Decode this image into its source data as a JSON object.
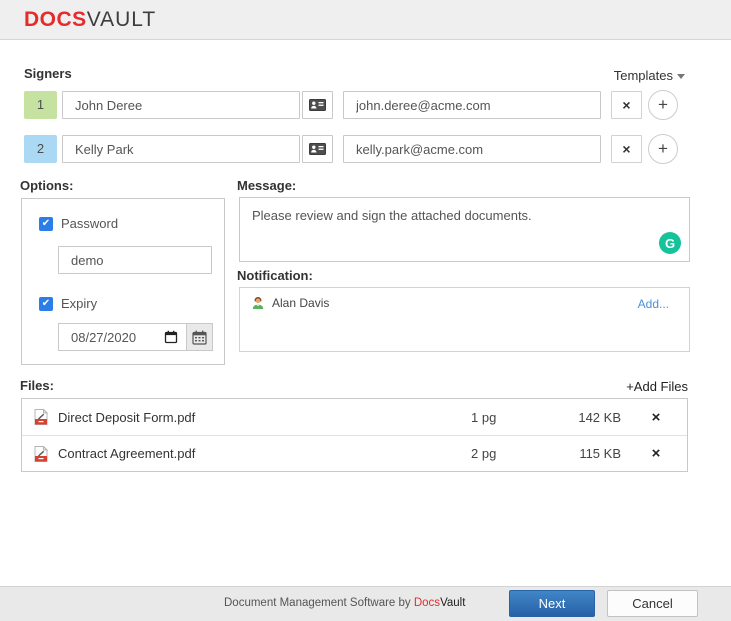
{
  "logo": {
    "docs": "DOCS",
    "vault": "VAULT"
  },
  "signers": {
    "label": "Signers",
    "templates_label": "Templates",
    "remove_label": "×",
    "add_label": "+",
    "rows": [
      {
        "order": "1",
        "name": "John Deree",
        "email": "john.deree@acme.com"
      },
      {
        "order": "2",
        "name": "Kelly Park",
        "email": "kelly.park@acme.com"
      }
    ]
  },
  "options": {
    "label": "Options:",
    "password_label": "Password",
    "password_value": "demo",
    "expiry_label": "Expiry",
    "expiry_value": "08/27/2020"
  },
  "message": {
    "label": "Message:",
    "value": "Please review and sign the attached documents.",
    "grammarly_letter": "G"
  },
  "notification": {
    "label": "Notification:",
    "recipient_name": "Alan Davis",
    "add_label": "Add..."
  },
  "files": {
    "label": "Files:",
    "add_label": "+Add Files",
    "remove_label": "×",
    "items": [
      {
        "name": "Direct Deposit Form.pdf",
        "pages": "1 pg",
        "size": "142 KB"
      },
      {
        "name": "Contract Agreement.pdf",
        "pages": "2 pg",
        "size": "115 KB"
      }
    ]
  },
  "footer": {
    "tagline_prefix": "Document Management Software by ",
    "brand_docs": "Docs",
    "brand_vault": "Vault",
    "next_label": "Next",
    "cancel_label": "Cancel"
  },
  "colors": {
    "brand_red": "#e62b2b",
    "badge_green": "#c6e2a0",
    "badge_blue": "#abd8f3",
    "checkbox_blue": "#2b7de9",
    "grammarly_green": "#15c39a",
    "link_blue": "#4a90d9",
    "next_button_blue": "#2f6cb0"
  }
}
